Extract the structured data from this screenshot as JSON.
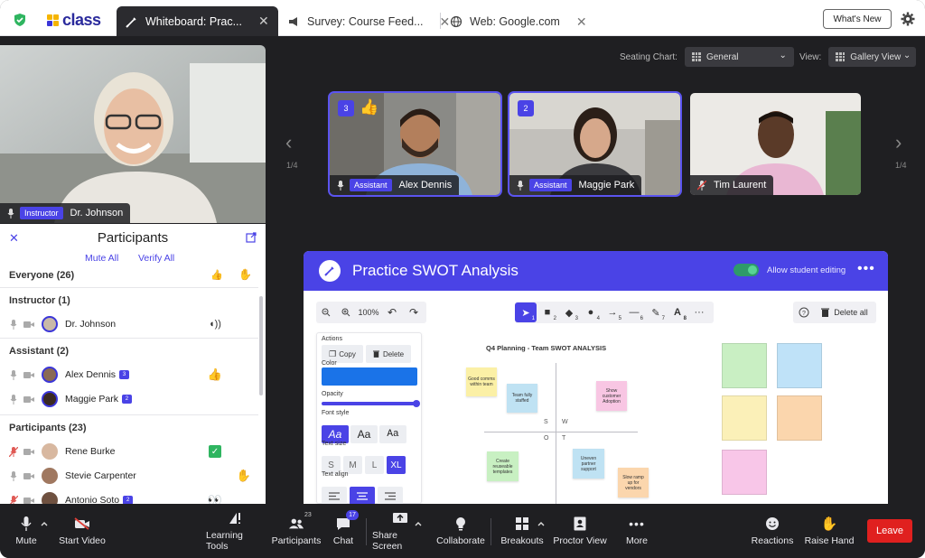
{
  "tabs": [
    {
      "label": "Whiteboard: Prac...",
      "icon": "whiteboard-icon"
    },
    {
      "label": "Survey: Course Feed...",
      "icon": "megaphone-icon"
    },
    {
      "label": "Web: Google.com",
      "icon": "globe-icon"
    }
  ],
  "logo_text": "class",
  "whats_new": "What's New",
  "seating_chart": {
    "label": "Seating Chart:",
    "value": "General"
  },
  "view": {
    "label": "View:",
    "value": "Gallery View"
  },
  "instructor": {
    "role": "Instructor",
    "name": "Dr. Johnson"
  },
  "gallery": {
    "tiles": [
      {
        "badge": "3",
        "role": "Assistant",
        "name": "Alex Dennis"
      },
      {
        "badge": "2",
        "role": "Assistant",
        "name": "Maggie Park"
      },
      {
        "name": "Tim Laurent"
      }
    ],
    "pager_left": "1/4",
    "pager_right": "1/4"
  },
  "participants": {
    "title": "Participants",
    "mute_all": "Mute All",
    "verify_all": "Verify All",
    "everyone": "Everyone (26)",
    "sections": [
      {
        "label": "Instructor (1)",
        "people": [
          {
            "name": "Dr. Johnson"
          }
        ]
      },
      {
        "label": "Assistant (2)",
        "people": [
          {
            "name": "Alex Dennis",
            "badge": "3"
          },
          {
            "name": "Maggie Park",
            "badge": "2"
          }
        ]
      },
      {
        "label": "Participants (23)",
        "people": [
          {
            "name": "Rene Burke"
          },
          {
            "name": "Stevie Carpenter"
          },
          {
            "name": "Antonio Soto",
            "badge": "2"
          }
        ]
      }
    ]
  },
  "whiteboard": {
    "title": "Practice SWOT Analysis",
    "allow_editing": "Allow student editing",
    "zoom": "100%",
    "delete_all": "Delete all",
    "tool_numbers": [
      "1",
      "2",
      "3",
      "4",
      "5",
      "6",
      "7",
      "8"
    ],
    "props": {
      "actions": "Actions",
      "copy": "Copy",
      "delete": "Delete",
      "color": "Color",
      "color_value": "#1a73e8",
      "opacity": "Opacity",
      "font_style": "Font style",
      "font_styles": [
        "Aa",
        "Aa",
        "Aa"
      ],
      "text_size": "Text size",
      "sizes": [
        "S",
        "M",
        "L",
        "XL"
      ],
      "text_align": "Text align"
    },
    "canvas_title": "Q4 Planning - Team SWOT ANALYSIS",
    "quadrants": [
      "S",
      "W",
      "O",
      "T"
    ],
    "stickies": [
      "Good comms within team",
      "Team fully staffed",
      "Show customer Adoption",
      "Create reuseable templates",
      "Uneven partner support",
      "Slow ramp up for vendors"
    ]
  },
  "bottombar": {
    "mute": "Mute",
    "start_video": "Start Video",
    "learning_tools": "Learning Tools",
    "participants": "Participants",
    "participants_count": "23",
    "chat": "Chat",
    "chat_badge": "17",
    "share_screen": "Share Screen",
    "collaborate": "Collaborate",
    "breakouts": "Breakouts",
    "proctor_view": "Proctor View",
    "more": "More",
    "reactions": "Reactions",
    "raise_hand": "Raise Hand",
    "leave": "Leave"
  }
}
